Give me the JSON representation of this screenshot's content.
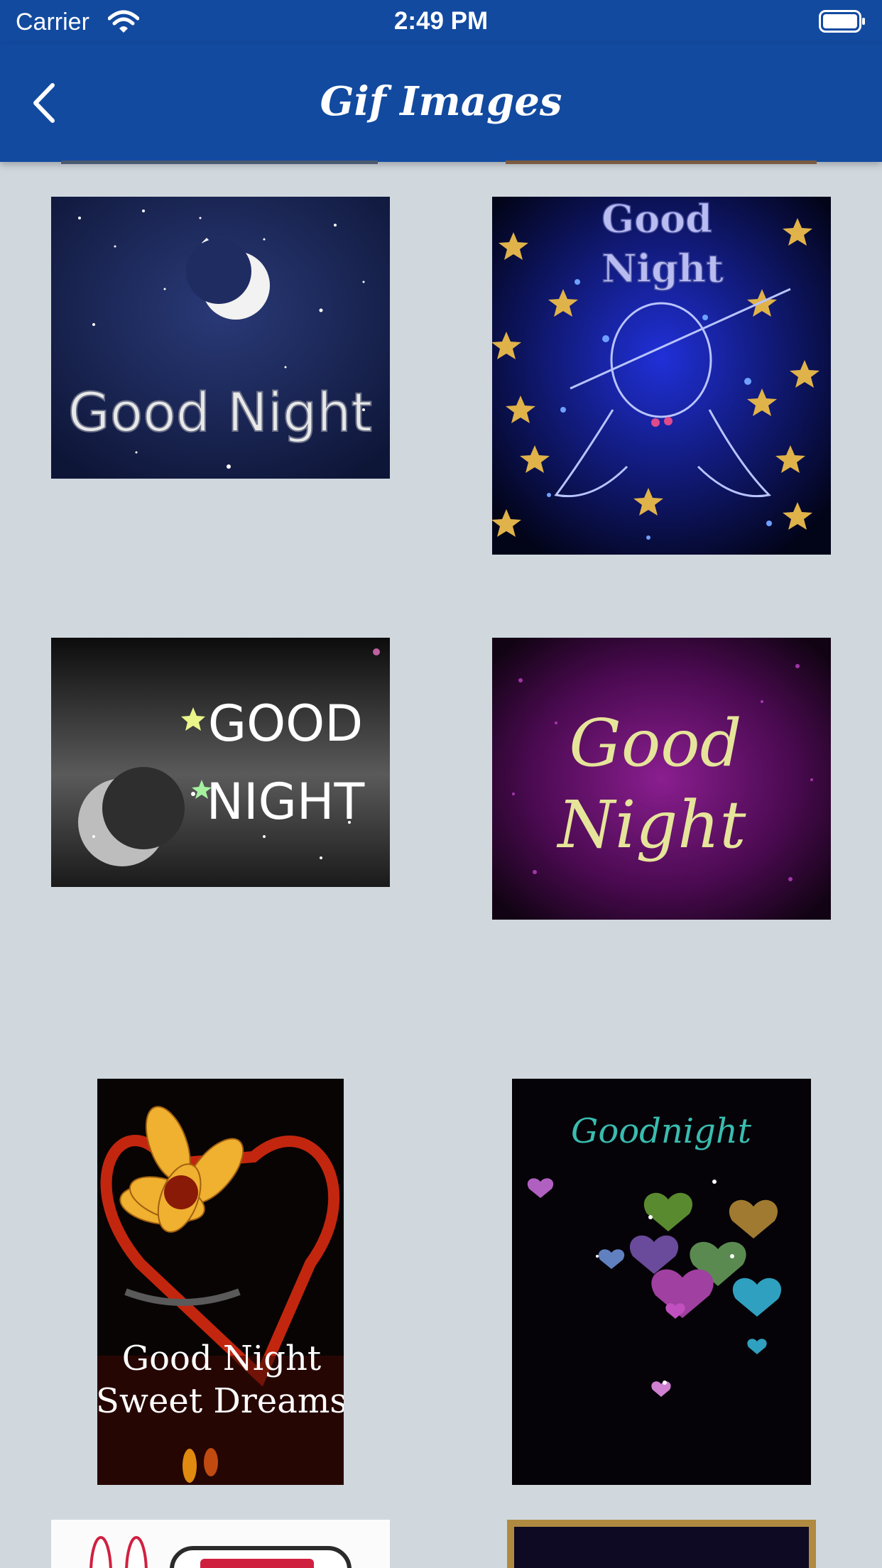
{
  "status_bar": {
    "carrier": "Carrier",
    "time": "2:49 PM"
  },
  "header": {
    "title": "Gif Images",
    "back_icon": "chevron-left-icon"
  },
  "colors": {
    "nav_bar": "#124aa0",
    "background": "#d0d8de"
  },
  "grid": {
    "items": [
      {
        "name": "gif-good-night-moon",
        "caption_lines": [
          "Good Night"
        ]
      },
      {
        "name": "gif-good-night-angel-stars",
        "caption_lines": [
          "Good",
          "Night"
        ]
      },
      {
        "name": "gif-good-night-crescent",
        "caption_lines": [
          "GOOD",
          "NIGHT"
        ]
      },
      {
        "name": "gif-good-night-purple",
        "caption_lines": [
          "Good",
          "Night"
        ]
      },
      {
        "name": "gif-good-night-sweet-dreams",
        "caption_lines": [
          "Good Night",
          "Sweet Dreams"
        ]
      },
      {
        "name": "gif-goodnight-hearts",
        "caption_lines": [
          "Goodnight"
        ]
      }
    ]
  }
}
